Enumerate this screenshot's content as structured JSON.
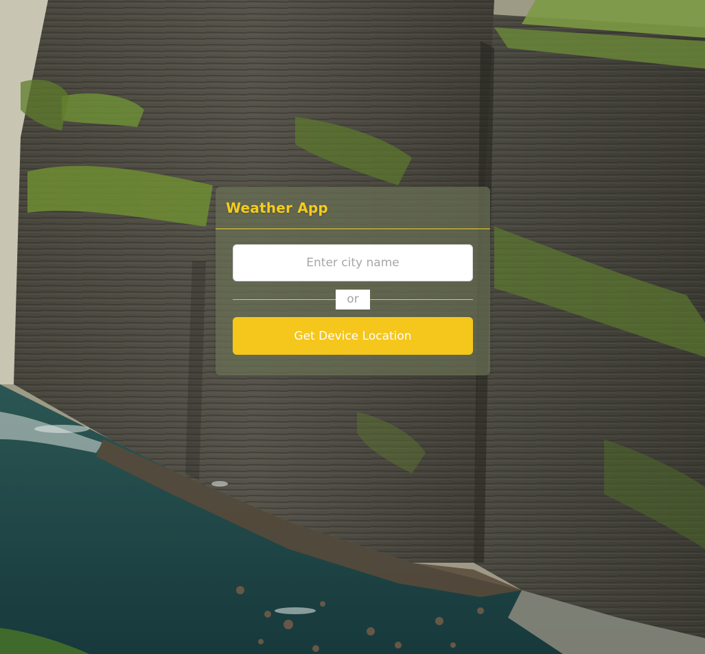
{
  "app": {
    "title": "Weather App"
  },
  "search": {
    "placeholder": "Enter city name",
    "value": ""
  },
  "separator": {
    "label": "or"
  },
  "location_button": {
    "label": "Get Device Location"
  },
  "background": {
    "subject": "sea cliffs above a rocky cove",
    "colors": {
      "cliff_dark": "#3b3a33",
      "cliff_mid": "#5c5a4d",
      "moss": "#5d7a30",
      "grass": "#6f8f3a",
      "water": "#1e4a4c",
      "sky": "#c9c6b4"
    }
  },
  "colors": {
    "accent": "#f5c61b",
    "title": "#f5cc1d",
    "card_tint": "#697055",
    "input_bg": "#ffffff"
  }
}
